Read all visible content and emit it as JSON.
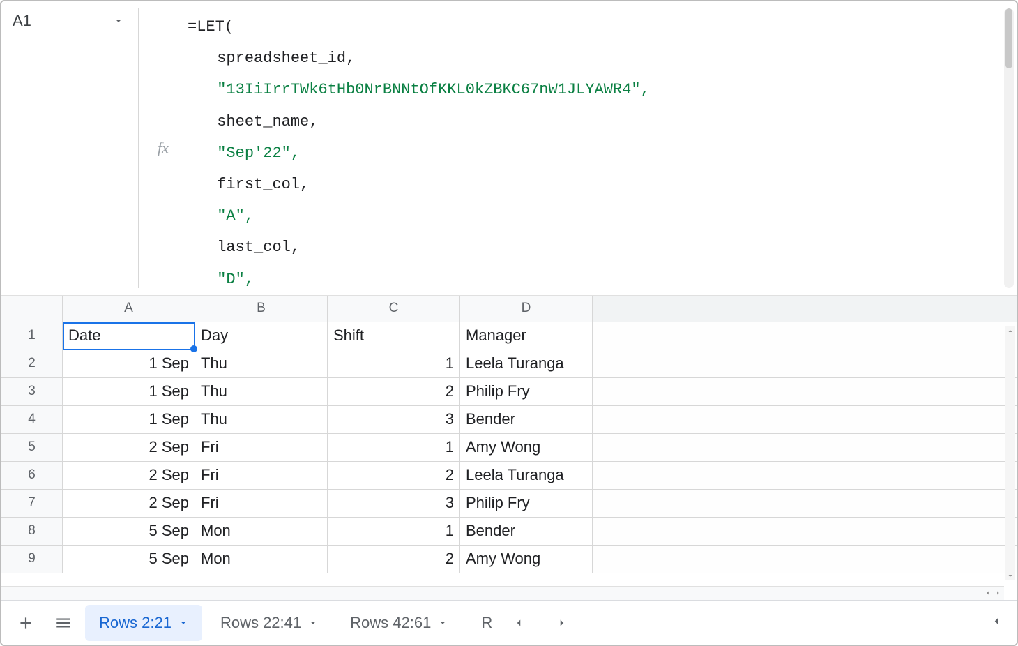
{
  "name_box": {
    "value": "A1"
  },
  "formula": {
    "tokens": [
      {
        "t": "=LET(",
        "indent": 0,
        "cls": ""
      },
      {
        "t": "spreadsheet_id,",
        "indent": 1,
        "cls": ""
      },
      {
        "t": "\"13IiIrrTWk6tHb0NrBNNtOfKKL0kZBKC67nW1JLYAWR4\",",
        "indent": 1,
        "cls": "str"
      },
      {
        "t": "sheet_name,",
        "indent": 1,
        "cls": ""
      },
      {
        "t": "\"Sep'22\",",
        "indent": 1,
        "cls": "str"
      },
      {
        "t": "first_col,",
        "indent": 1,
        "cls": ""
      },
      {
        "t": "\"A\",",
        "indent": 1,
        "cls": "str"
      },
      {
        "t": "last_col,",
        "indent": 1,
        "cls": ""
      },
      {
        "t": "\"D\",",
        "indent": 1,
        "cls": "str"
      }
    ]
  },
  "columns": [
    "A",
    "B",
    "C",
    "D"
  ],
  "table": {
    "headers": {
      "A": "Date",
      "B": "Day",
      "C": "Shift",
      "D": "Manager"
    },
    "rows": [
      {
        "n": "1",
        "A": "Date",
        "B": "Day",
        "C": "Shift",
        "D": "Manager",
        "is_header": true
      },
      {
        "n": "2",
        "A": "1 Sep",
        "B": "Thu",
        "C": "1",
        "D": "Leela Turanga"
      },
      {
        "n": "3",
        "A": "1 Sep",
        "B": "Thu",
        "C": "2",
        "D": "Philip Fry"
      },
      {
        "n": "4",
        "A": "1 Sep",
        "B": "Thu",
        "C": "3",
        "D": "Bender"
      },
      {
        "n": "5",
        "A": "2 Sep",
        "B": "Fri",
        "C": "1",
        "D": "Amy Wong"
      },
      {
        "n": "6",
        "A": "2 Sep",
        "B": "Fri",
        "C": "2",
        "D": "Leela Turanga"
      },
      {
        "n": "7",
        "A": "2 Sep",
        "B": "Fri",
        "C": "3",
        "D": "Philip Fry"
      },
      {
        "n": "8",
        "A": "5 Sep",
        "B": "Mon",
        "C": "1",
        "D": "Bender"
      },
      {
        "n": "9",
        "A": "5 Sep",
        "B": "Mon",
        "C": "2",
        "D": "Amy Wong"
      }
    ]
  },
  "tabs": [
    {
      "label": "Rows 2:21",
      "active": true
    },
    {
      "label": "Rows 22:41",
      "active": false
    },
    {
      "label": "Rows 42:61",
      "active": false
    }
  ],
  "tab_overflow_hint": "R",
  "selection": {
    "cell": "A1"
  }
}
